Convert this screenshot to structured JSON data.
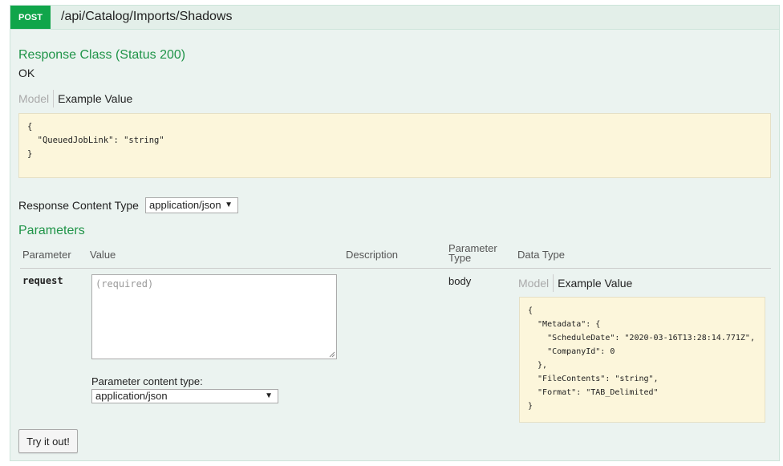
{
  "endpoint": {
    "method": "POST",
    "path": "/api/Catalog/Imports/Shadows"
  },
  "response": {
    "title": "Response Class (Status 200)",
    "status_text": "OK",
    "tab_model": "Model",
    "tab_example": "Example Value",
    "example_json": "{\n  \"QueuedJobLink\": \"string\"\n}"
  },
  "response_content_type": {
    "label": "Response Content Type",
    "selected": "application/json"
  },
  "parameters": {
    "title": "Parameters",
    "headers": {
      "parameter": "Parameter",
      "value": "Value",
      "description": "Description",
      "parameter_type_line1": "Parameter",
      "parameter_type_line2": "Type",
      "data_type": "Data Type"
    },
    "row": {
      "name": "request",
      "placeholder": "(required)",
      "type": "body",
      "tab_model": "Model",
      "tab_example": "Example Value",
      "example_json": "{\n  \"Metadata\": {\n    \"ScheduleDate\": \"2020-03-16T13:28:14.771Z\",\n    \"CompanyId\": 0\n  },\n  \"FileContents\": \"string\",\n  \"Format\": \"TAB_Delimited\"\n}",
      "content_type_label": "Parameter content type:",
      "content_type_selected": "application/json"
    }
  },
  "try_button": "Try it out!",
  "colors": {
    "method_bg": "#10a54a",
    "section_title": "#1f9448",
    "panel_bg": "#ebf3f0",
    "snippet_bg": "#fcf6db"
  }
}
